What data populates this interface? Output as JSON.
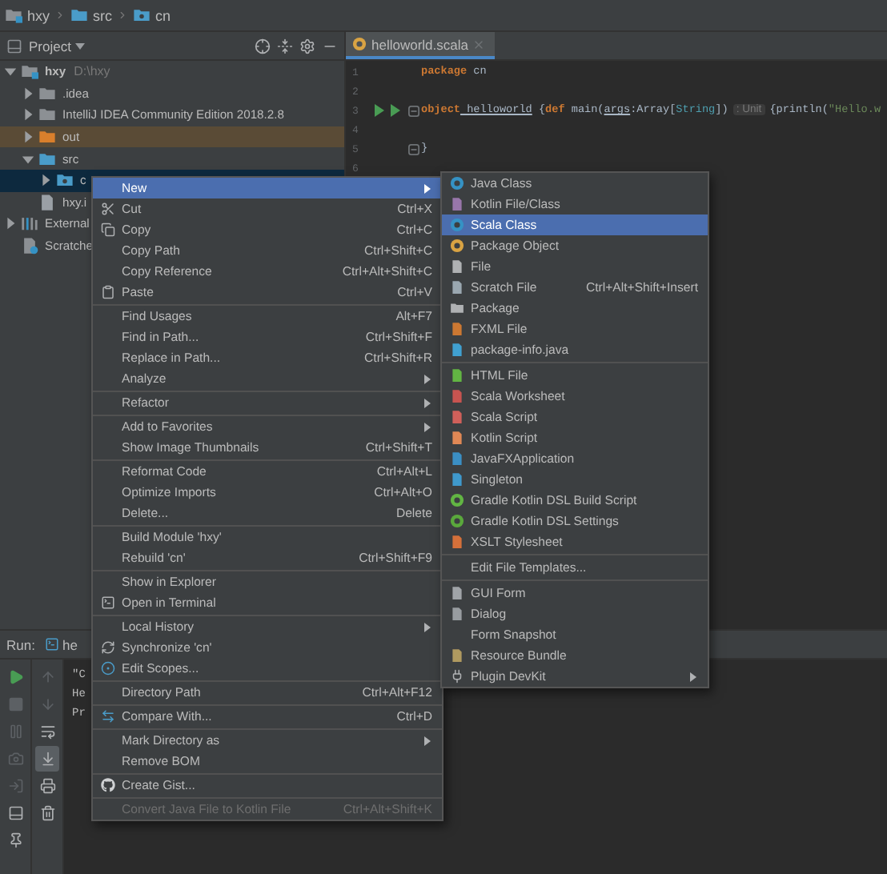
{
  "breadcrumb": [
    {
      "label": "hxy",
      "kind": "module"
    },
    {
      "label": "src",
      "kind": "folder"
    },
    {
      "label": "cn",
      "kind": "package"
    }
  ],
  "project": {
    "title": "Project",
    "tree": [
      {
        "label": "hxy",
        "path": "D:\\hxy",
        "kind": "module",
        "expanded": true,
        "selected": false,
        "children": [
          {
            "label": ".idea",
            "kind": "folder",
            "color": "#8c9094",
            "expanded": false,
            "selected": false
          },
          {
            "label": "IntelliJ IDEA Community Edition 2018.2.8",
            "kind": "folder",
            "color": "#8c9094",
            "expanded": false,
            "selected": false
          },
          {
            "label": "out",
            "kind": "folder",
            "color": "#d97f2c",
            "expanded": false,
            "selected": false,
            "excluded": true
          },
          {
            "label": "src",
            "kind": "folder",
            "color": "#4a9cc9",
            "expanded": true,
            "selected": false,
            "children": [
              {
                "label": "c",
                "kind": "package",
                "expanded": false,
                "selected": true
              }
            ]
          },
          {
            "label": "hxy.i",
            "kind": "module-file",
            "selected": false
          }
        ]
      },
      {
        "label": "External",
        "kind": "libraries",
        "expanded": false,
        "selected": false
      },
      {
        "label": "Scratche",
        "kind": "scratches",
        "selected": false
      }
    ]
  },
  "editor": {
    "tab": {
      "label": "helloworld.scala"
    },
    "lines": [
      {
        "number": "1",
        "tokens": [
          {
            "text": "package",
            "kind": "keyword"
          },
          {
            "text": " cn",
            "kind": "plain"
          }
        ]
      },
      {
        "number": "2"
      },
      {
        "number": "3",
        "runnable": true,
        "fold": true,
        "tokens": [
          {
            "text": "object",
            "kind": "keyword"
          },
          {
            "text": " helloworld",
            "kind": "ident"
          },
          {
            "text": " {",
            "kind": "plain"
          },
          {
            "text": "def",
            "kind": "keyword"
          },
          {
            "text": " main(",
            "kind": "plain"
          },
          {
            "text": "args",
            "kind": "ident"
          },
          {
            "text": ":Array[",
            "kind": "plain"
          },
          {
            "text": "String",
            "kind": "type"
          },
          {
            "text": "])",
            "kind": "plain"
          },
          {
            "text": ": Unit",
            "kind": "hint"
          },
          {
            "text": "{println(",
            "kind": "plain"
          },
          {
            "text": "\"Hello.w",
            "kind": "string"
          }
        ]
      },
      {
        "number": "4"
      },
      {
        "number": "5",
        "fold": true,
        "tokens": [
          {
            "text": "}",
            "kind": "plain"
          }
        ]
      },
      {
        "number": "6"
      }
    ]
  },
  "run_panel": {
    "title": "Run:",
    "tab": "he",
    "left_tools": [
      {
        "kind": "play",
        "disabled": false
      },
      {
        "kind": "stop",
        "disabled": true
      },
      {
        "kind": "pause",
        "disabled": true
      },
      {
        "kind": "camera",
        "disabled": true
      },
      {
        "kind": "exit",
        "disabled": true
      },
      {
        "kind": "layout",
        "disabled": false
      },
      {
        "kind": "pin",
        "disabled": false
      }
    ],
    "right_tools": [
      {
        "kind": "up",
        "disabled": true,
        "on": false
      },
      {
        "kind": "down",
        "disabled": true,
        "on": false
      },
      {
        "kind": "wrap",
        "disabled": false,
        "on": false
      },
      {
        "kind": "scroll-end",
        "disabled": false,
        "on": true
      },
      {
        "kind": "print",
        "disabled": false,
        "on": false
      },
      {
        "kind": "trash",
        "disabled": false,
        "on": false
      }
    ],
    "console": [
      "\"C",
      "He",
      "Pr"
    ]
  },
  "context_menu": {
    "groups": [
      {
        "items": [
          {
            "label": "New",
            "submenu": true,
            "selected": true,
            "disabled": false
          },
          {
            "label": "Cut",
            "shortcut": "Ctrl+X",
            "kind": "cut",
            "submenu": false,
            "selected": false,
            "disabled": false
          },
          {
            "label": "Copy",
            "shortcut": "Ctrl+C",
            "kind": "copy",
            "submenu": false,
            "selected": false,
            "disabled": false
          },
          {
            "label": "Copy Path",
            "shortcut": "Ctrl+Shift+C",
            "submenu": false,
            "selected": false,
            "disabled": false
          },
          {
            "label": "Copy Reference",
            "shortcut": "Ctrl+Alt+Shift+C",
            "submenu": false,
            "selected": false,
            "disabled": false
          },
          {
            "label": "Paste",
            "shortcut": "Ctrl+V",
            "kind": "paste",
            "submenu": false,
            "selected": false,
            "disabled": false
          }
        ]
      },
      {
        "items": [
          {
            "label": "Find Usages",
            "shortcut": "Alt+F7",
            "submenu": false,
            "selected": false,
            "disabled": false
          },
          {
            "label": "Find in Path...",
            "shortcut": "Ctrl+Shift+F",
            "submenu": false,
            "selected": false,
            "disabled": false
          },
          {
            "label": "Replace in Path...",
            "shortcut": "Ctrl+Shift+R",
            "submenu": false,
            "selected": false,
            "disabled": false
          },
          {
            "label": "Analyze",
            "submenu": true,
            "selected": false,
            "disabled": false
          }
        ]
      },
      {
        "items": [
          {
            "label": "Refactor",
            "submenu": true,
            "selected": false,
            "disabled": false
          }
        ]
      },
      {
        "items": [
          {
            "label": "Add to Favorites",
            "submenu": true,
            "selected": false,
            "disabled": false
          },
          {
            "label": "Show Image Thumbnails",
            "shortcut": "Ctrl+Shift+T",
            "submenu": false,
            "selected": false,
            "disabled": false
          }
        ]
      },
      {
        "items": [
          {
            "label": "Reformat Code",
            "shortcut": "Ctrl+Alt+L",
            "submenu": false,
            "selected": false,
            "disabled": false
          },
          {
            "label": "Optimize Imports",
            "shortcut": "Ctrl+Alt+O",
            "submenu": false,
            "selected": false,
            "disabled": false
          },
          {
            "label": "Delete...",
            "shortcut": "Delete",
            "submenu": false,
            "selected": false,
            "disabled": false
          }
        ]
      },
      {
        "items": [
          {
            "label": "Build Module 'hxy'",
            "submenu": false,
            "selected": false,
            "disabled": false
          },
          {
            "label": "Rebuild 'cn'",
            "shortcut": "Ctrl+Shift+F9",
            "submenu": false,
            "selected": false,
            "disabled": false
          }
        ]
      },
      {
        "items": [
          {
            "label": "Show in Explorer",
            "submenu": false,
            "selected": false,
            "disabled": false
          },
          {
            "label": "Open in Terminal",
            "kind": "terminal",
            "submenu": false,
            "selected": false,
            "disabled": false
          }
        ]
      },
      {
        "items": [
          {
            "label": "Local History",
            "submenu": true,
            "selected": false,
            "disabled": false
          },
          {
            "label": "Synchronize 'cn'",
            "kind": "sync",
            "submenu": false,
            "selected": false,
            "disabled": false
          },
          {
            "label": "Edit Scopes...",
            "kind": "scope",
            "submenu": false,
            "selected": false,
            "disabled": false
          }
        ]
      },
      {
        "items": [
          {
            "label": "Directory Path",
            "shortcut": "Ctrl+Alt+F12",
            "submenu": false,
            "selected": false,
            "disabled": false
          }
        ]
      },
      {
        "items": [
          {
            "label": "Compare With...",
            "shortcut": "Ctrl+D",
            "kind": "compare",
            "submenu": false,
            "selected": false,
            "disabled": false
          }
        ]
      },
      {
        "items": [
          {
            "label": "Mark Directory as",
            "submenu": true,
            "selected": false,
            "disabled": false
          },
          {
            "label": "Remove BOM",
            "submenu": false,
            "selected": false,
            "disabled": false
          }
        ]
      },
      {
        "items": [
          {
            "label": "Create Gist...",
            "kind": "github",
            "submenu": false,
            "selected": false,
            "disabled": false
          }
        ]
      },
      {
        "items": [
          {
            "label": "Convert Java File to Kotlin File",
            "shortcut": "Ctrl+Alt+Shift+K",
            "submenu": false,
            "selected": false,
            "disabled": true
          }
        ]
      }
    ]
  },
  "submenu": {
    "groups": [
      {
        "items": [
          {
            "label": "Java Class",
            "kind": "circle",
            "color": "#3592c4",
            "submenu": false,
            "selected": false,
            "disabled": false
          },
          {
            "label": "Kotlin File/Class",
            "kind": "file",
            "color": "#9876aa",
            "submenu": false,
            "selected": false,
            "disabled": false
          },
          {
            "label": "Scala Class",
            "kind": "circle",
            "color": "#3592c4",
            "submenu": false,
            "selected": true,
            "disabled": false
          },
          {
            "label": "Package Object",
            "kind": "circle",
            "color": "#d9a343",
            "submenu": false,
            "selected": false,
            "disabled": false
          },
          {
            "label": "File",
            "kind": "file",
            "color": "#afb1b3",
            "submenu": false,
            "selected": false,
            "disabled": false
          },
          {
            "label": "Scratch File",
            "shortcut": "Ctrl+Alt+Shift+Insert",
            "kind": "file",
            "color": "#9aa7b0",
            "submenu": false,
            "selected": false,
            "disabled": false
          },
          {
            "label": "Package",
            "kind": "folder",
            "color": "#afb1b3",
            "submenu": false,
            "selected": false,
            "disabled": false
          },
          {
            "label": "FXML File",
            "kind": "file",
            "color": "#cc7832",
            "submenu": false,
            "selected": false,
            "disabled": false
          },
          {
            "label": "package-info.java",
            "kind": "file",
            "color": "#40a0d0",
            "submenu": false,
            "selected": false,
            "disabled": false
          }
        ]
      },
      {
        "items": [
          {
            "label": "HTML File",
            "kind": "file",
            "color": "#62b543",
            "submenu": false,
            "selected": false,
            "disabled": false
          },
          {
            "label": "Scala Worksheet",
            "kind": "file",
            "color": "#c75450",
            "submenu": false,
            "selected": false,
            "disabled": false
          },
          {
            "label": "Scala Script",
            "kind": "file",
            "color": "#d0605a",
            "submenu": false,
            "selected": false,
            "disabled": false
          },
          {
            "label": "Kotlin Script",
            "kind": "file",
            "color": "#e08855",
            "submenu": false,
            "selected": false,
            "disabled": false
          },
          {
            "label": "JavaFXApplication",
            "kind": "file",
            "color": "#3b8fc4",
            "submenu": false,
            "selected": false,
            "disabled": false
          },
          {
            "label": "Singleton",
            "kind": "file",
            "color": "#3f99cc",
            "submenu": false,
            "selected": false,
            "disabled": false
          },
          {
            "label": "Gradle Kotlin DSL Build Script",
            "kind": "circle",
            "color": "#62b543",
            "submenu": false,
            "selected": false,
            "disabled": false
          },
          {
            "label": "Gradle Kotlin DSL Settings",
            "kind": "circle",
            "color": "#5aa83c",
            "submenu": false,
            "selected": false,
            "disabled": false
          },
          {
            "label": "XSLT Stylesheet",
            "kind": "file",
            "color": "#d4703a",
            "submenu": false,
            "selected": false,
            "disabled": false
          }
        ]
      },
      {
        "items": [
          {
            "label": "Edit File Templates...",
            "submenu": false,
            "selected": false,
            "disabled": false
          }
        ]
      },
      {
        "items": [
          {
            "label": "GUI Form",
            "kind": "file",
            "color": "#a0a4a8",
            "submenu": false,
            "selected": false,
            "disabled": false
          },
          {
            "label": "Dialog",
            "kind": "file",
            "color": "#989ca0",
            "submenu": false,
            "selected": false,
            "disabled": false
          },
          {
            "label": "Form Snapshot",
            "submenu": false,
            "selected": false,
            "disabled": false
          },
          {
            "label": "Resource Bundle",
            "kind": "file",
            "color": "#b09a60",
            "submenu": false,
            "selected": false,
            "disabled": false
          },
          {
            "label": "Plugin DevKit",
            "kind": "plugin",
            "color": "#afb1b3",
            "submenu": true,
            "selected": false,
            "disabled": false
          }
        ]
      }
    ]
  }
}
